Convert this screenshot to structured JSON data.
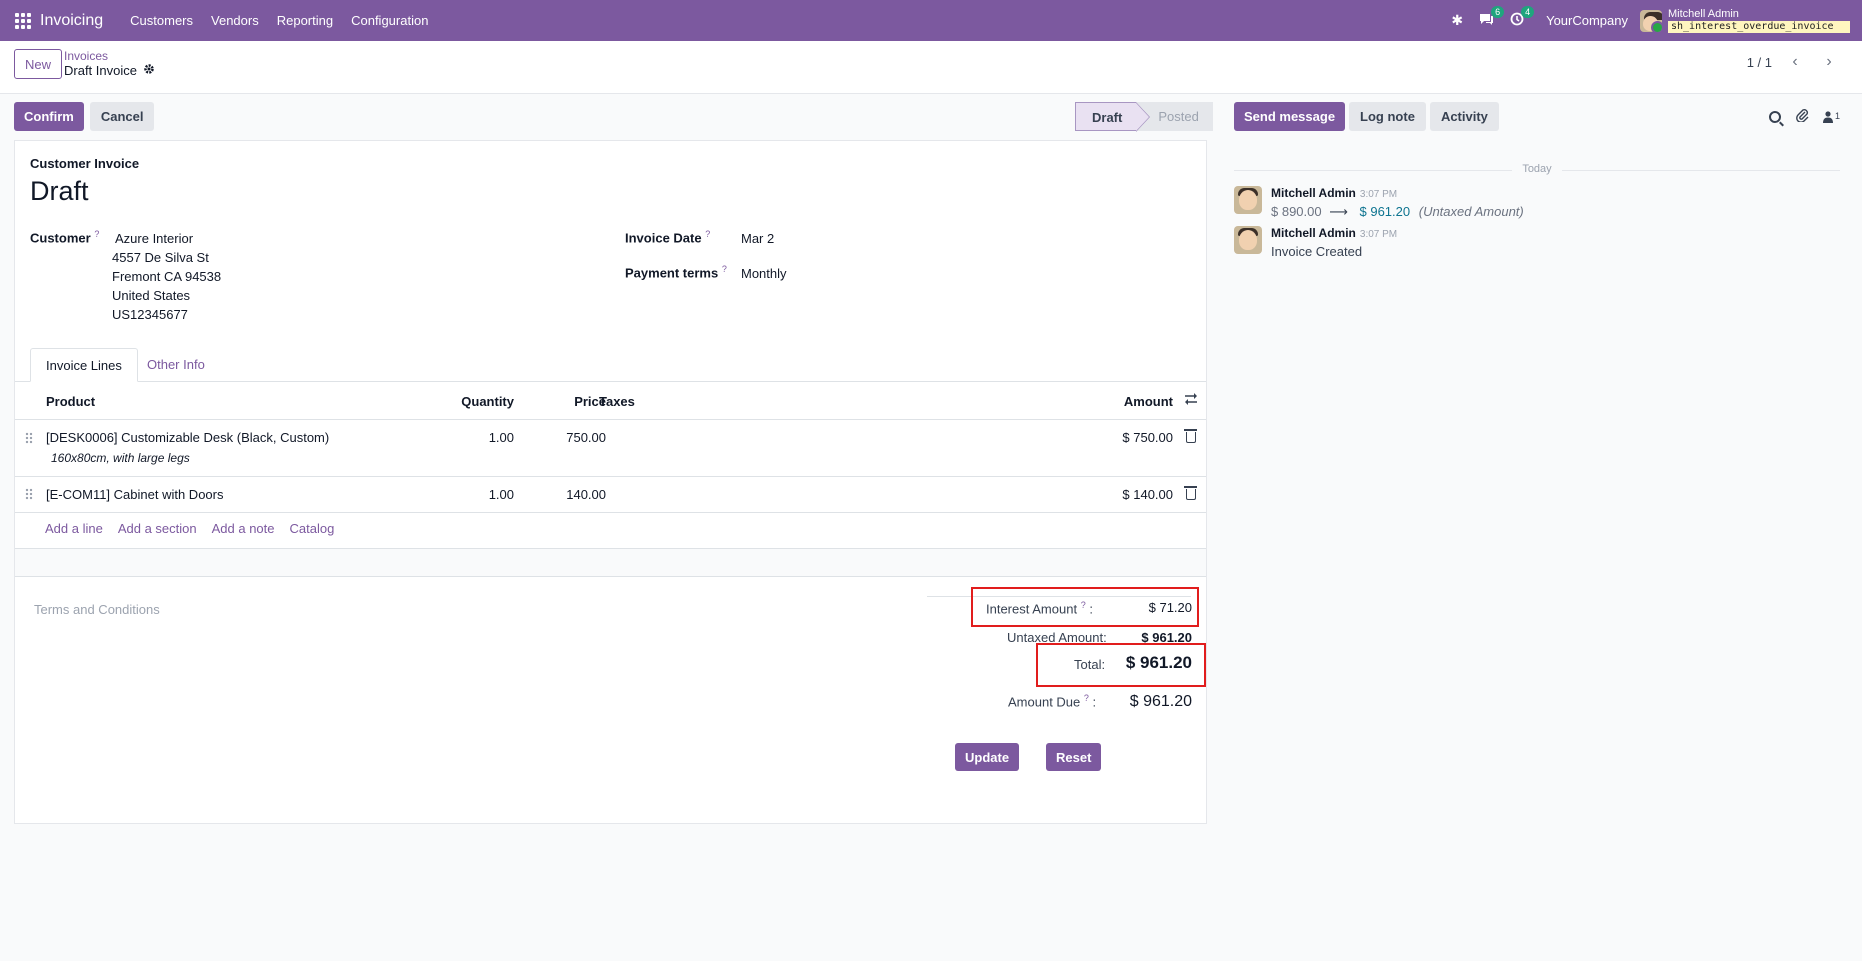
{
  "navbar": {
    "app_name": "Invoicing",
    "menu": [
      "Customers",
      "Vendors",
      "Reporting",
      "Configuration"
    ],
    "messages_count": "6",
    "activities_count": "4",
    "company": "YourCompany",
    "user_name": "Mitchell Admin",
    "database": "sh_interest_overdue_invoice"
  },
  "control_panel": {
    "new_label": "New",
    "breadcrumb_parent": "Invoices",
    "breadcrumb_current": "Draft Invoice",
    "pager": "1 / 1"
  },
  "form": {
    "confirm_label": "Confirm",
    "cancel_label": "Cancel",
    "status": [
      "Draft",
      "Posted"
    ],
    "doc_type": "Customer Invoice",
    "doc_name": "Draft",
    "customer_label": "Customer",
    "customer_name": "Azure Interior",
    "customer_address": [
      "4557 De Silva St",
      "Fremont CA 94538",
      "United States",
      "US12345677"
    ],
    "invoice_date_label": "Invoice Date",
    "invoice_date": "Mar 2",
    "payment_terms_label": "Payment terms",
    "payment_terms": "Monthly",
    "help_mark": "?",
    "tabs": [
      "Invoice Lines",
      "Other Info"
    ],
    "columns": {
      "product": "Product",
      "quantity": "Quantity",
      "price": "Price",
      "taxes": "Taxes",
      "amount": "Amount"
    },
    "lines": [
      {
        "product": "[DESK0006] Customizable Desk (Black, Custom)",
        "description": "160x80cm, with large legs",
        "quantity": "1.00",
        "price": "750.00",
        "amount": "$ 750.00"
      },
      {
        "product": "[E-COM11] Cabinet with Doors",
        "description": "",
        "quantity": "1.00",
        "price": "140.00",
        "amount": "$ 140.00"
      }
    ],
    "add_links": [
      "Add a line",
      "Add a section",
      "Add a note",
      "Catalog"
    ],
    "terms_placeholder": "Terms and Conditions",
    "totals": {
      "interest_label": "Interest Amount",
      "interest_value": "$ 71.20",
      "untaxed_label": "Untaxed Amount:",
      "untaxed_value": "$ 961.20",
      "total_label": "Total:",
      "total_value": "$ 961.20",
      "amount_due_label": "Amount Due",
      "amount_due_value": "$ 961.20",
      "colon": ":"
    },
    "update_label": "Update",
    "reset_label": "Reset"
  },
  "chatter": {
    "send_message": "Send message",
    "log_note": "Log note",
    "activity": "Activity",
    "followers_count": "1",
    "today": "Today",
    "messages": [
      {
        "author": "Mitchell Admin",
        "time": "3:07 PM",
        "old_value": "$ 890.00",
        "new_value": "$ 961.20",
        "field": "(Untaxed Amount)"
      },
      {
        "author": "Mitchell Admin",
        "time": "3:07 PM",
        "body": "Invoice Created"
      }
    ]
  },
  "colors": {
    "brand": "#7c599f",
    "highlight": "#e11d1d",
    "badge": "#1fa57d"
  }
}
